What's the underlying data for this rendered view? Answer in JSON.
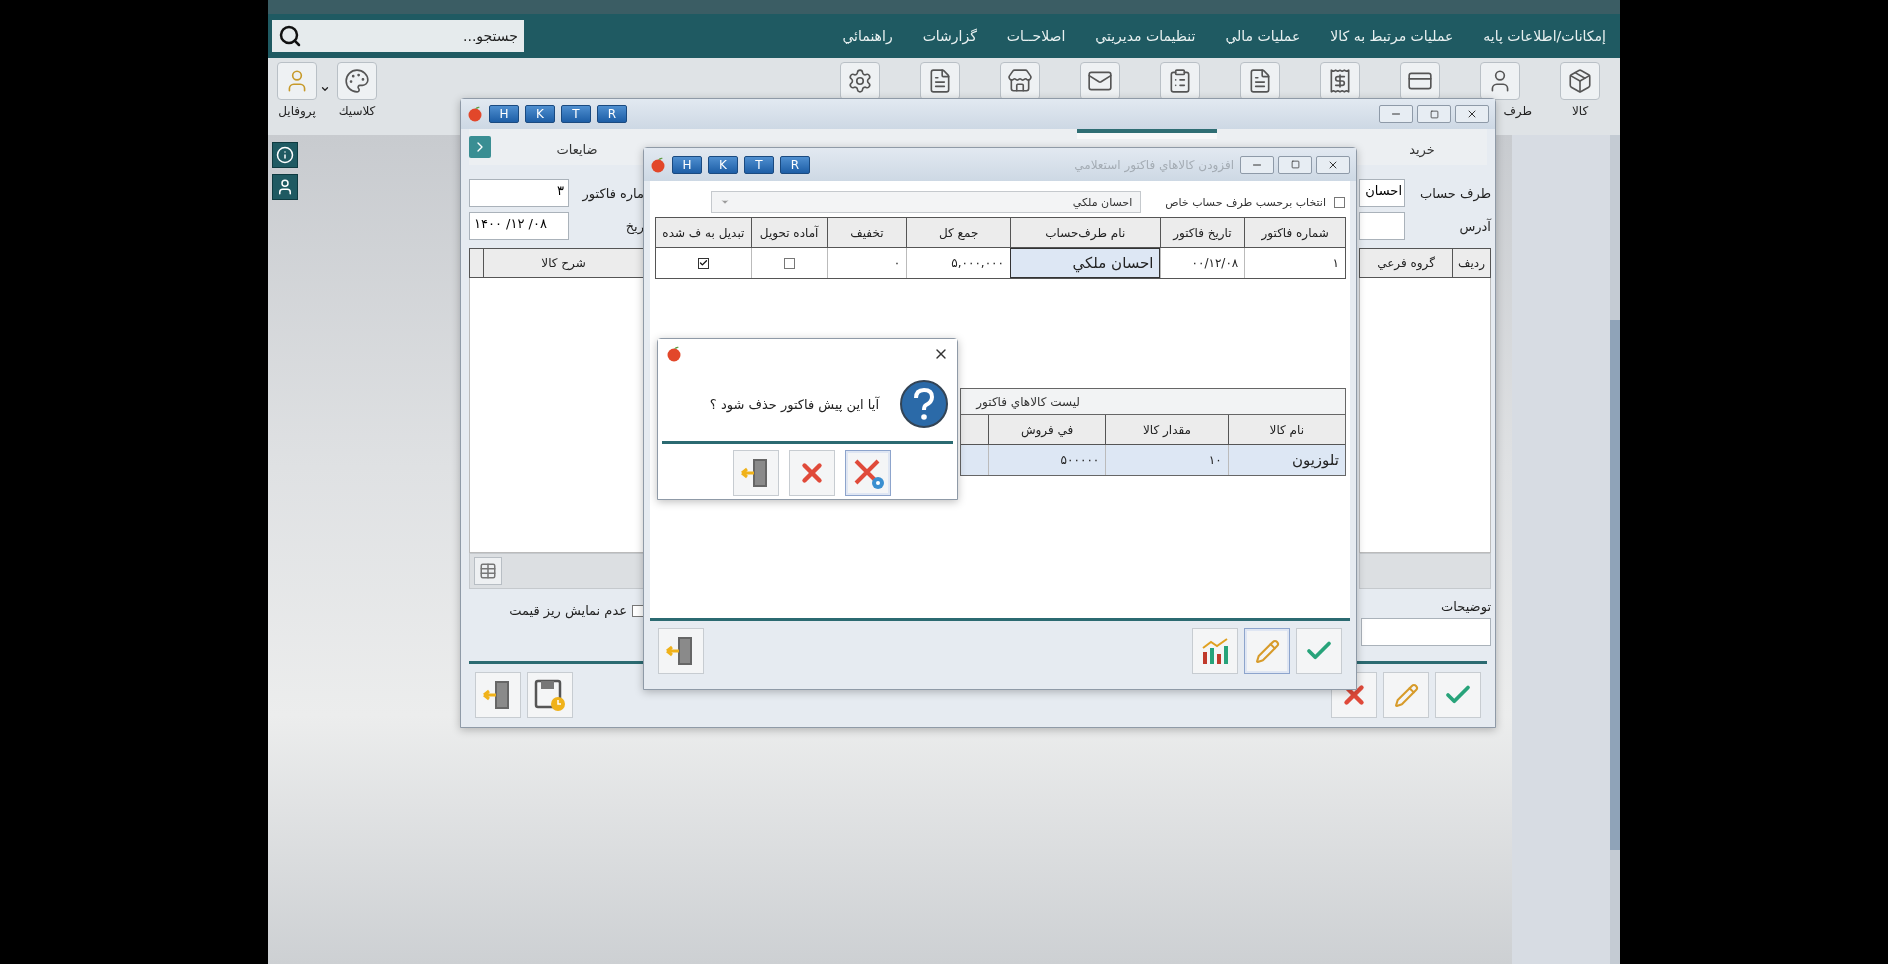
{
  "menu_bar": {
    "search": {
      "placeholder": "جستجو..."
    },
    "items": [
      "إمكانات/اطلاعات پايه",
      "عمليات مرتبط به كالا",
      "عمليات مالي",
      "تنظيمات مديريتي",
      "اصلاحــات",
      "گزارشات",
      "راهنمائي"
    ]
  },
  "toolbar": {
    "left_items": [
      {
        "label": "كلاسيك",
        "kind": "theme"
      },
      {
        "label": "پروفايل",
        "kind": "profile"
      }
    ],
    "right_items": [
      {
        "label": "كالا",
        "kind": "box"
      },
      {
        "label": "طرف",
        "kind": "person"
      },
      {
        "kind": "card"
      },
      {
        "kind": "register"
      },
      {
        "kind": "edit"
      },
      {
        "kind": "list"
      },
      {
        "kind": "mail"
      },
      {
        "kind": "shop"
      },
      {
        "kind": "report"
      },
      {
        "kind": "gear"
      }
    ]
  },
  "invoice_window": {
    "title_buttons": [
      "R",
      "T",
      "K",
      "H"
    ],
    "tabs": [
      {
        "label": "خريد",
        "selected": false
      },
      {
        "selected": true
      },
      {
        "label": "ضايعات",
        "selected": false
      }
    ],
    "account_label": "طرف حساب",
    "account_value": "احسان",
    "address_label": "آدرس",
    "invoice_no_label": "ماره فاكتور",
    "invoice_no_value": "۳",
    "date_label": "ريخ",
    "date_value": "۱۴۰۰ /۱۲ /۰۸",
    "columns_right": [
      "رديف",
      "گروه فرعي"
    ],
    "columns_left": [
      "شرح كالا"
    ],
    "notes_label": "توضيحات",
    "hide_price_detail": {
      "label": "عدم نمايش ريز قيمت",
      "checked": false
    }
  },
  "inquiry_window": {
    "title": "افزودن كالاهاي فاكتور استعلامي",
    "title_buttons": [
      "R",
      "T",
      "K",
      "H"
    ],
    "filter": {
      "label": "انتخاب برحسب طرف حساب خاص",
      "checked": false
    },
    "account_select": {
      "value": "احسان ملكي"
    },
    "invoices": {
      "columns": [
        "شماره فاكتور",
        "تاريخ فاكتور",
        "نام طرف‌حساب",
        "جمع كل",
        "تخفيف",
        "آماده تحويل",
        "تبديل به ف شده"
      ],
      "rows": [
        {
          "cells": [
            {
              "kind": "text",
              "text": "۱",
              "selected": false
            },
            {
              "kind": "text",
              "text": "۰۰/۱۲/۰۸",
              "selected": false
            },
            {
              "kind": "text",
              "text": "احسان ملكي",
              "selected": true
            },
            {
              "kind": "text",
              "text": "۵,۰۰۰,۰۰۰",
              "selected": false
            },
            {
              "kind": "text",
              "text": "۰",
              "selected": false
            },
            {
              "kind": "check",
              "checked": false
            },
            {
              "kind": "check",
              "checked": true
            }
          ]
        }
      ]
    },
    "items_table": {
      "title": "ليست كالاهاي فاكتور",
      "columns": [
        "نام كالا",
        "مقدار كالا",
        "في فروش"
      ],
      "rows": [
        {
          "cells": [
            "تلوزيون",
            "۱۰",
            "۵۰۰۰۰۰"
          ],
          "selected": true
        }
      ]
    }
  },
  "confirm_dialog": {
    "message": "آيا اين پيش فاكتور حذف شود ؟"
  }
}
